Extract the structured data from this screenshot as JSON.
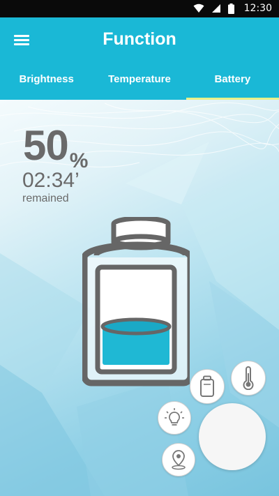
{
  "status_bar": {
    "time": "12:30"
  },
  "app_bar": {
    "title": "Function",
    "tabs": [
      {
        "label": "Brightness",
        "active": false
      },
      {
        "label": "Temperature",
        "active": false
      },
      {
        "label": "Battery",
        "active": true
      }
    ]
  },
  "battery": {
    "percent_value": "50",
    "percent_sign": "%",
    "time_remaining": "02:34’",
    "remained_label": "remained",
    "fill_level": 0.5
  },
  "fab_menu": {
    "items": [
      {
        "icon": "battery-icon"
      },
      {
        "icon": "thermometer-icon"
      },
      {
        "icon": "lightbulb-icon"
      },
      {
        "icon": "location-pin-icon"
      }
    ]
  },
  "colors": {
    "accent": "#1ab8d6",
    "tab_indicator": "#e8f08a",
    "text_gray": "#6a6a6a",
    "battery_fill": "#1fb8d4"
  }
}
